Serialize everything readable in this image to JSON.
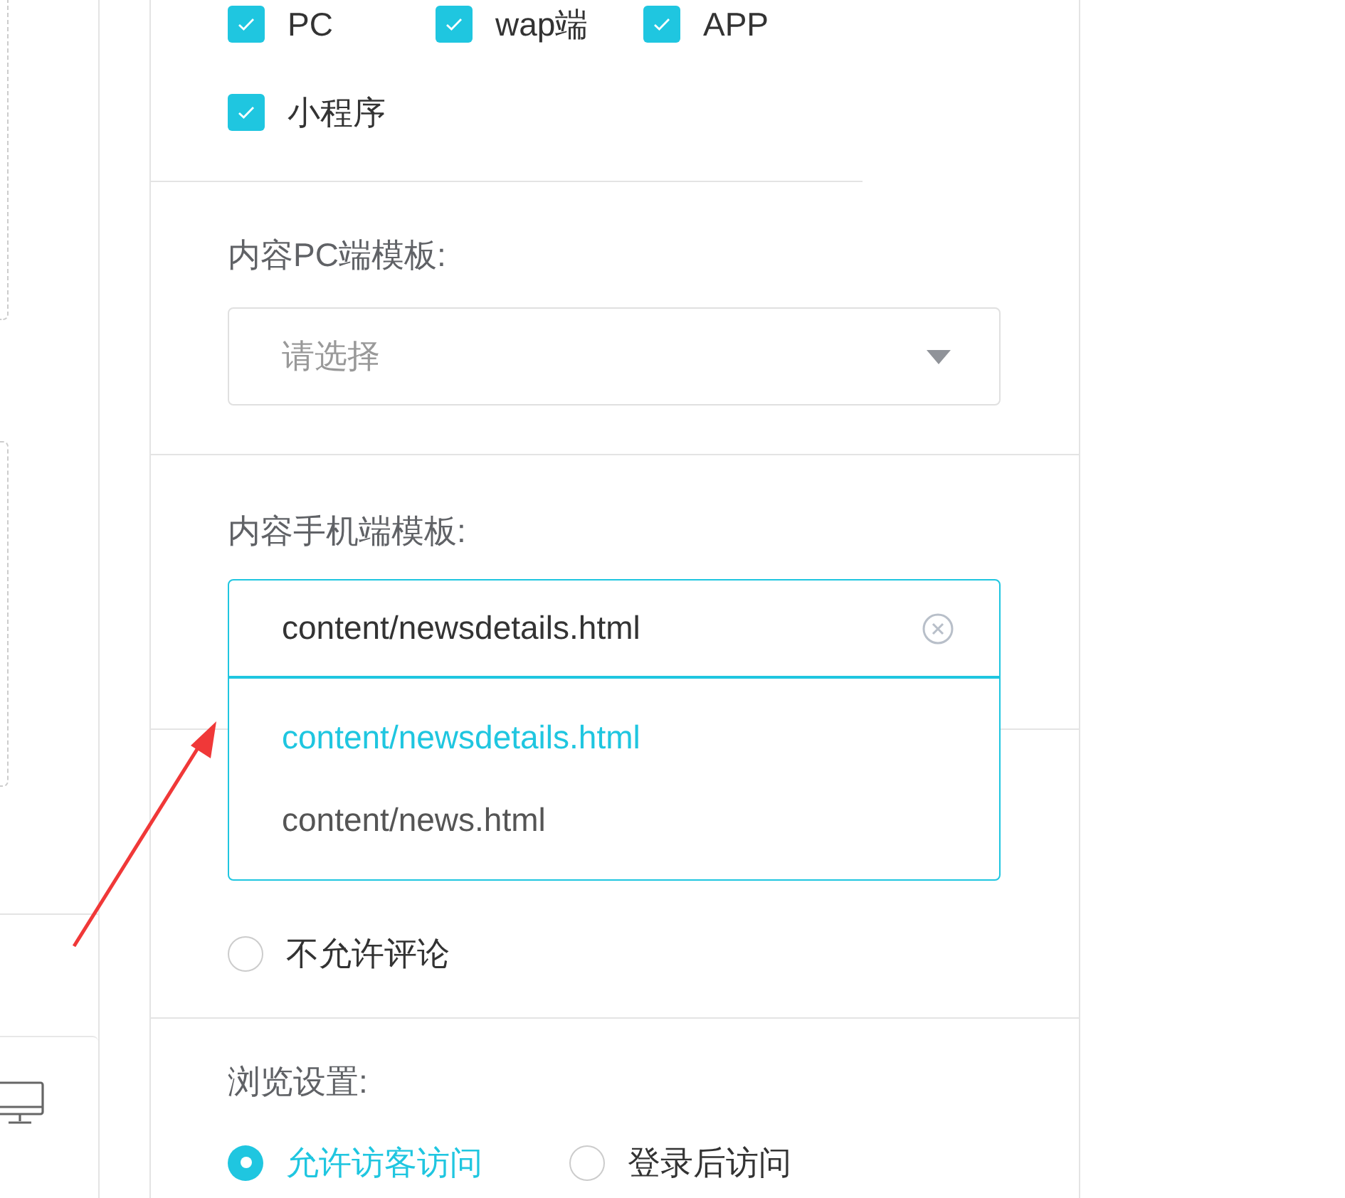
{
  "platforms": [
    {
      "label": "PC",
      "checked": true
    },
    {
      "label": "wap端",
      "checked": true
    },
    {
      "label": "APP",
      "checked": true
    },
    {
      "label": "小程序",
      "checked": true
    }
  ],
  "pc_template": {
    "label": "内容PC端模板:",
    "placeholder": "请选择",
    "expanded": false
  },
  "mobile_template": {
    "label": "内容手机端模板:",
    "value": "content/newsdetails.html",
    "expanded": true,
    "options": [
      {
        "label": "content/newsdetails.html",
        "selected": true
      },
      {
        "label": "content/news.html",
        "selected": false
      }
    ]
  },
  "comment_options": [
    {
      "label": "不允许评论",
      "selected": false
    }
  ],
  "browse": {
    "label": "浏览设置:",
    "options": [
      {
        "label": "允许访客访问",
        "selected": true
      },
      {
        "label": "登录后访问",
        "selected": false
      }
    ]
  }
}
